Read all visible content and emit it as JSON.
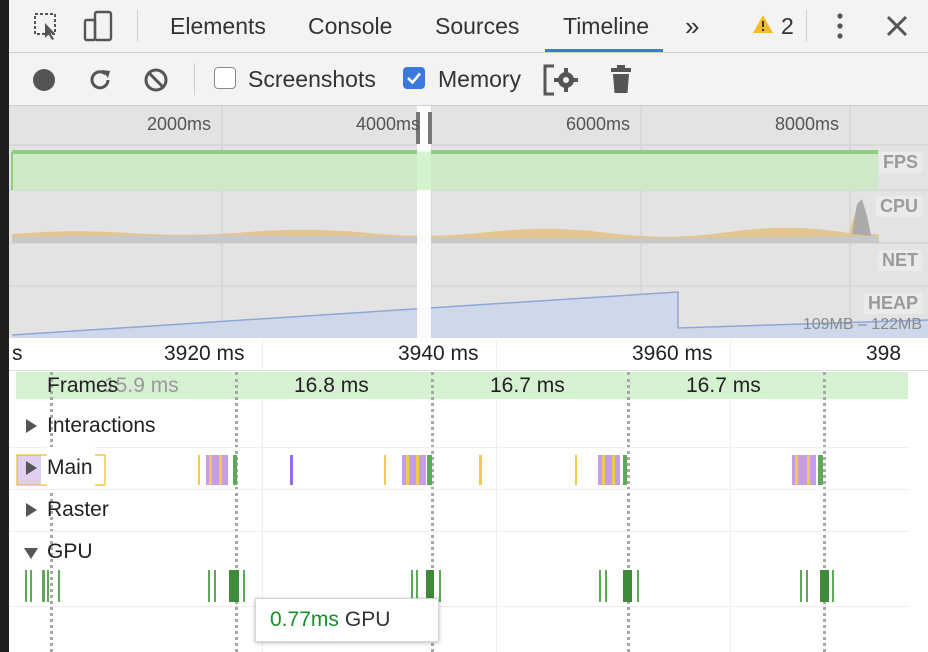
{
  "tabs": {
    "items": [
      "Elements",
      "Console",
      "Sources",
      "Timeline"
    ],
    "active": "Timeline",
    "more": "»",
    "warning_count": "2",
    "menu_icon": "kebab-menu-icon",
    "close_icon": "close-icon"
  },
  "toolbar": {
    "record_icon": "record-icon",
    "reload_icon": "reload-icon",
    "clear_icon": "clear-icon",
    "screenshots_label": "Screenshots",
    "screenshots_checked": false,
    "memory_label": "Memory",
    "memory_checked": true,
    "settings_icon": "capture-settings-icon",
    "gc_icon": "trash-icon"
  },
  "overview": {
    "ticks": [
      "2000ms",
      "4000ms",
      "6000ms",
      "8000ms"
    ],
    "tracks": [
      "FPS",
      "CPU",
      "NET",
      "HEAP"
    ],
    "heap_range": "109MB – 122MB"
  },
  "flamechart": {
    "ruler_ticks": [
      "s",
      "3920 ms",
      "3940 ms",
      "3960 ms",
      "398"
    ],
    "frames_label": "Frames",
    "frame_values": [
      "15.9 ms",
      "16.8 ms",
      "16.7 ms",
      "16.7 ms"
    ],
    "rows": {
      "interactions": "Interactions",
      "main": "Main",
      "raster": "Raster",
      "gpu": "GPU"
    }
  },
  "tooltip": {
    "value": "0.77ms",
    "label": "GPU"
  },
  "colors": {
    "accent": "#3879d9",
    "fps_green": "#8ccf7f",
    "cpu_yellow": "#e3b95c",
    "heap_blue": "#9db4e3",
    "scripting": "#f2c94c",
    "rendering": "#c49fe8",
    "painting": "#5ea85a",
    "tooltip_value": "#188f2a"
  }
}
